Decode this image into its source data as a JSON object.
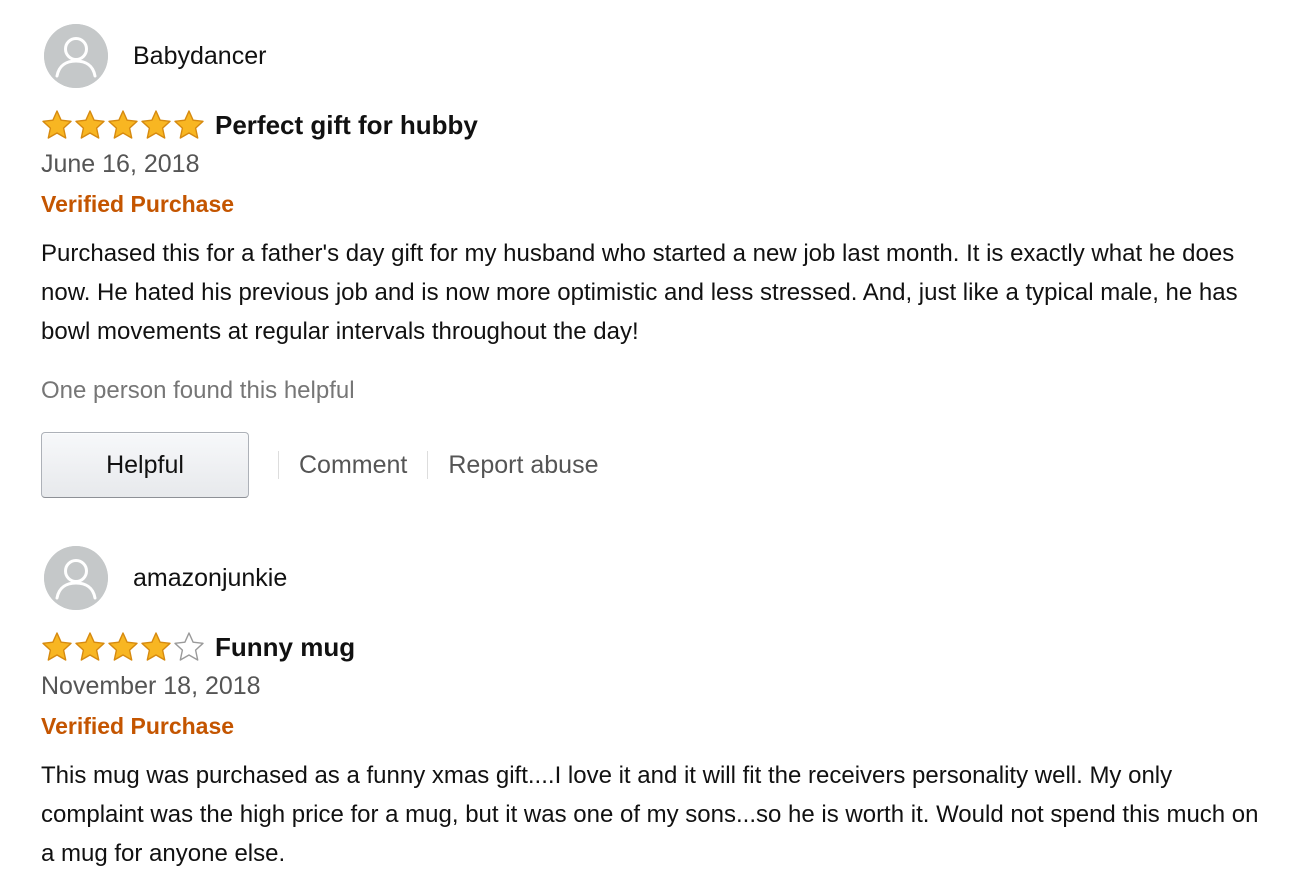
{
  "reviews": [
    {
      "username": "Babydancer",
      "avatar_icon": "default-profile-avatar-icon",
      "rating": 5,
      "max_rating": 5,
      "title": "Perfect gift for hubby",
      "date": "June 16, 2018",
      "verified": "Verified Purchase",
      "body": "Purchased this for a father's day gift for my husband who started a new job last month. It is exactly what he does now. He hated his previous job and is now more optimistic and less stressed. And, just like a typical male, he has bowl movements at regular intervals throughout the day!",
      "helpful_count_text": "One person found this helpful",
      "helpful_label": "Helpful",
      "comment_label": "Comment",
      "report_label": "Report abuse"
    },
    {
      "username": "amazonjunkie",
      "avatar_icon": "default-profile-avatar-icon",
      "rating": 4,
      "max_rating": 5,
      "title": "Funny mug",
      "date": "November 18, 2018",
      "verified": "Verified Purchase",
      "body": "This mug was purchased as a funny xmas gift....I love it and it will fit the receivers personality well. My only complaint was the high price for a mug, but it was one of my sons...so he is worth it. Would not spend this much on a mug for anyone else."
    }
  ],
  "colors": {
    "star_fill": "#f8b622",
    "star_stroke": "#d68a10",
    "star_empty_stroke": "#9a9a9a",
    "verified": "#c45500",
    "avatar_bg": "#c5c8c9"
  }
}
